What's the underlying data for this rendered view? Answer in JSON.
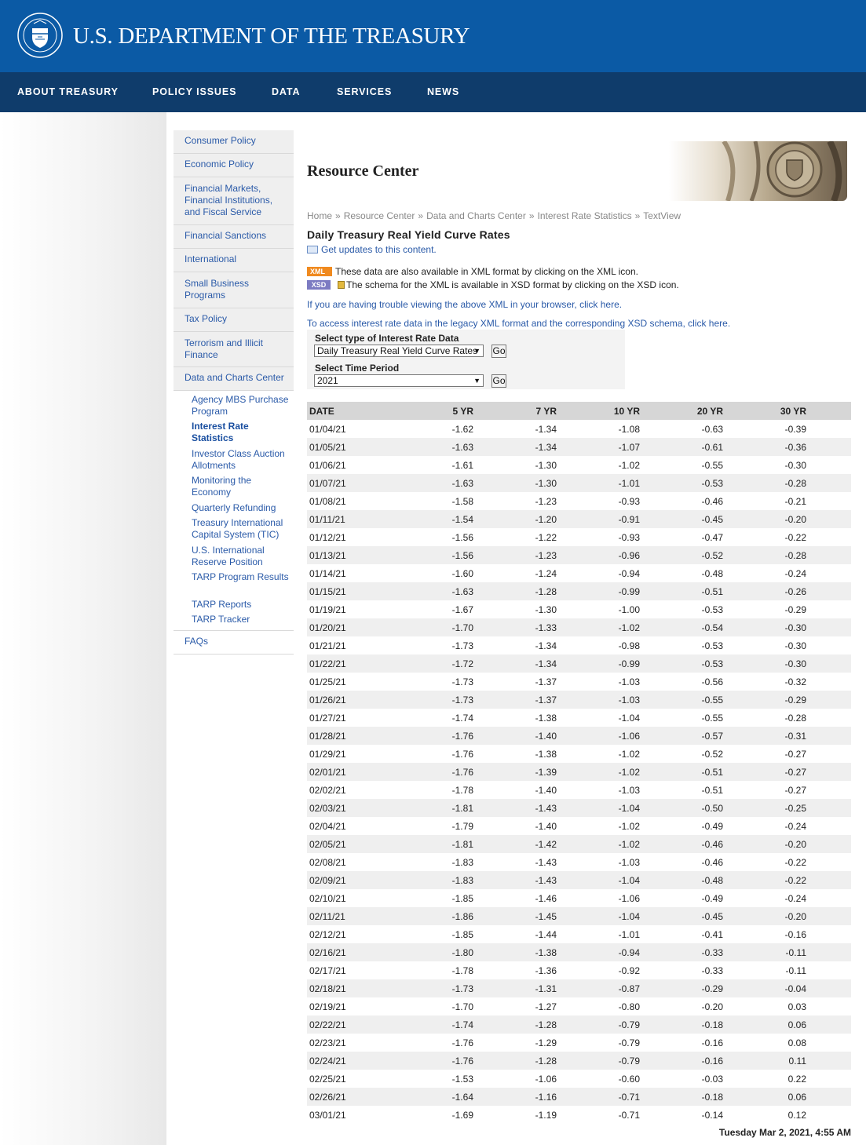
{
  "header": {
    "title": "U.S. DEPARTMENT OF THE TREASURY",
    "seal_text": "THE DEPARTMENT OF THE TREASURY",
    "seal_year": "1789"
  },
  "nav": [
    "ABOUT TREASURY",
    "POLICY ISSUES",
    "DATA",
    "SERVICES",
    "NEWS"
  ],
  "sidebar": {
    "items": [
      "Consumer Policy",
      "Economic Policy",
      "Financial Markets, Financial Institutions, and Fiscal Service",
      "Financial Sanctions",
      "International",
      "Small Business Programs",
      "Tax Policy",
      "Terrorism and Illicit Finance",
      "Data and Charts Center"
    ],
    "subitems": [
      "Agency MBS Purchase Program",
      "Interest Rate Statistics",
      "Investor Class Auction Allotments",
      "Monitoring the Economy",
      "Quarterly Refunding",
      "Treasury International Capital System (TIC)",
      "U.S. International Reserve Position",
      "TARP Program Results",
      "TARP Reports",
      "TARP Tracker"
    ],
    "faqs": "FAQs"
  },
  "main": {
    "resource_title": "Resource Center",
    "breadcrumb": [
      "Home",
      "Resource Center",
      "Data and Charts Center",
      "Interest Rate Statistics",
      "TextView"
    ],
    "breadcrumb_sep": "»",
    "page_title": "Daily Treasury Real Yield Curve Rates",
    "updates_link": "Get updates to this content.",
    "xml_badge": "XML",
    "xml_text": "These data are also available in XML format by clicking on the XML icon.",
    "xsd_badge": "XSD",
    "xsd_text": "The schema for the XML is available in XSD format by clicking on the XSD icon.",
    "trouble_text": "If you are having trouble viewing the above XML in your browser, click here.",
    "legacy_text": "To access interest rate data in the legacy XML format and the corresponding XSD schema, click here.",
    "form": {
      "type_label": "Select type of Interest Rate Data",
      "type_value": "Daily Treasury Real Yield Curve Rates",
      "period_label": "Select Time Period",
      "period_value": "2021",
      "go": "Go"
    },
    "table": {
      "headers": [
        "DATE",
        "5 YR",
        "7 YR",
        "10 YR",
        "20 YR",
        "30 YR"
      ],
      "rows": [
        [
          "01/04/21",
          "-1.62",
          "-1.34",
          "-1.08",
          "-0.63",
          "-0.39"
        ],
        [
          "01/05/21",
          "-1.63",
          "-1.34",
          "-1.07",
          "-0.61",
          "-0.36"
        ],
        [
          "01/06/21",
          "-1.61",
          "-1.30",
          "-1.02",
          "-0.55",
          "-0.30"
        ],
        [
          "01/07/21",
          "-1.63",
          "-1.30",
          "-1.01",
          "-0.53",
          "-0.28"
        ],
        [
          "01/08/21",
          "-1.58",
          "-1.23",
          "-0.93",
          "-0.46",
          "-0.21"
        ],
        [
          "01/11/21",
          "-1.54",
          "-1.20",
          "-0.91",
          "-0.45",
          "-0.20"
        ],
        [
          "01/12/21",
          "-1.56",
          "-1.22",
          "-0.93",
          "-0.47",
          "-0.22"
        ],
        [
          "01/13/21",
          "-1.56",
          "-1.23",
          "-0.96",
          "-0.52",
          "-0.28"
        ],
        [
          "01/14/21",
          "-1.60",
          "-1.24",
          "-0.94",
          "-0.48",
          "-0.24"
        ],
        [
          "01/15/21",
          "-1.63",
          "-1.28",
          "-0.99",
          "-0.51",
          "-0.26"
        ],
        [
          "01/19/21",
          "-1.67",
          "-1.30",
          "-1.00",
          "-0.53",
          "-0.29"
        ],
        [
          "01/20/21",
          "-1.70",
          "-1.33",
          "-1.02",
          "-0.54",
          "-0.30"
        ],
        [
          "01/21/21",
          "-1.73",
          "-1.34",
          "-0.98",
          "-0.53",
          "-0.30"
        ],
        [
          "01/22/21",
          "-1.72",
          "-1.34",
          "-0.99",
          "-0.53",
          "-0.30"
        ],
        [
          "01/25/21",
          "-1.73",
          "-1.37",
          "-1.03",
          "-0.56",
          "-0.32"
        ],
        [
          "01/26/21",
          "-1.73",
          "-1.37",
          "-1.03",
          "-0.55",
          "-0.29"
        ],
        [
          "01/27/21",
          "-1.74",
          "-1.38",
          "-1.04",
          "-0.55",
          "-0.28"
        ],
        [
          "01/28/21",
          "-1.76",
          "-1.40",
          "-1.06",
          "-0.57",
          "-0.31"
        ],
        [
          "01/29/21",
          "-1.76",
          "-1.38",
          "-1.02",
          "-0.52",
          "-0.27"
        ],
        [
          "02/01/21",
          "-1.76",
          "-1.39",
          "-1.02",
          "-0.51",
          "-0.27"
        ],
        [
          "02/02/21",
          "-1.78",
          "-1.40",
          "-1.03",
          "-0.51",
          "-0.27"
        ],
        [
          "02/03/21",
          "-1.81",
          "-1.43",
          "-1.04",
          "-0.50",
          "-0.25"
        ],
        [
          "02/04/21",
          "-1.79",
          "-1.40",
          "-1.02",
          "-0.49",
          "-0.24"
        ],
        [
          "02/05/21",
          "-1.81",
          "-1.42",
          "-1.02",
          "-0.46",
          "-0.20"
        ],
        [
          "02/08/21",
          "-1.83",
          "-1.43",
          "-1.03",
          "-0.46",
          "-0.22"
        ],
        [
          "02/09/21",
          "-1.83",
          "-1.43",
          "-1.04",
          "-0.48",
          "-0.22"
        ],
        [
          "02/10/21",
          "-1.85",
          "-1.46",
          "-1.06",
          "-0.49",
          "-0.24"
        ],
        [
          "02/11/21",
          "-1.86",
          "-1.45",
          "-1.04",
          "-0.45",
          "-0.20"
        ],
        [
          "02/12/21",
          "-1.85",
          "-1.44",
          "-1.01",
          "-0.41",
          "-0.16"
        ],
        [
          "02/16/21",
          "-1.80",
          "-1.38",
          "-0.94",
          "-0.33",
          "-0.11"
        ],
        [
          "02/17/21",
          "-1.78",
          "-1.36",
          "-0.92",
          "-0.33",
          "-0.11"
        ],
        [
          "02/18/21",
          "-1.73",
          "-1.31",
          "-0.87",
          "-0.29",
          "-0.04"
        ],
        [
          "02/19/21",
          "-1.70",
          "-1.27",
          "-0.80",
          "-0.20",
          "0.03"
        ],
        [
          "02/22/21",
          "-1.74",
          "-1.28",
          "-0.79",
          "-0.18",
          "0.06"
        ],
        [
          "02/23/21",
          "-1.76",
          "-1.29",
          "-0.79",
          "-0.16",
          "0.08"
        ],
        [
          "02/24/21",
          "-1.76",
          "-1.28",
          "-0.79",
          "-0.16",
          "0.11"
        ],
        [
          "02/25/21",
          "-1.53",
          "-1.06",
          "-0.60",
          "-0.03",
          "0.22"
        ],
        [
          "02/26/21",
          "-1.64",
          "-1.16",
          "-0.71",
          "-0.18",
          "0.06"
        ],
        [
          "03/01/21",
          "-1.69",
          "-1.19",
          "-0.71",
          "-0.14",
          "0.12"
        ]
      ]
    },
    "timestamp": "Tuesday Mar 2, 2021, 4:55 AM"
  },
  "colors": {
    "banner": "#0b5aa5",
    "navbar": "#0f3c6b",
    "link": "#2a5aa8",
    "xml_badge": "#f08a1f",
    "xsd_badge": "#7c7bc2"
  }
}
